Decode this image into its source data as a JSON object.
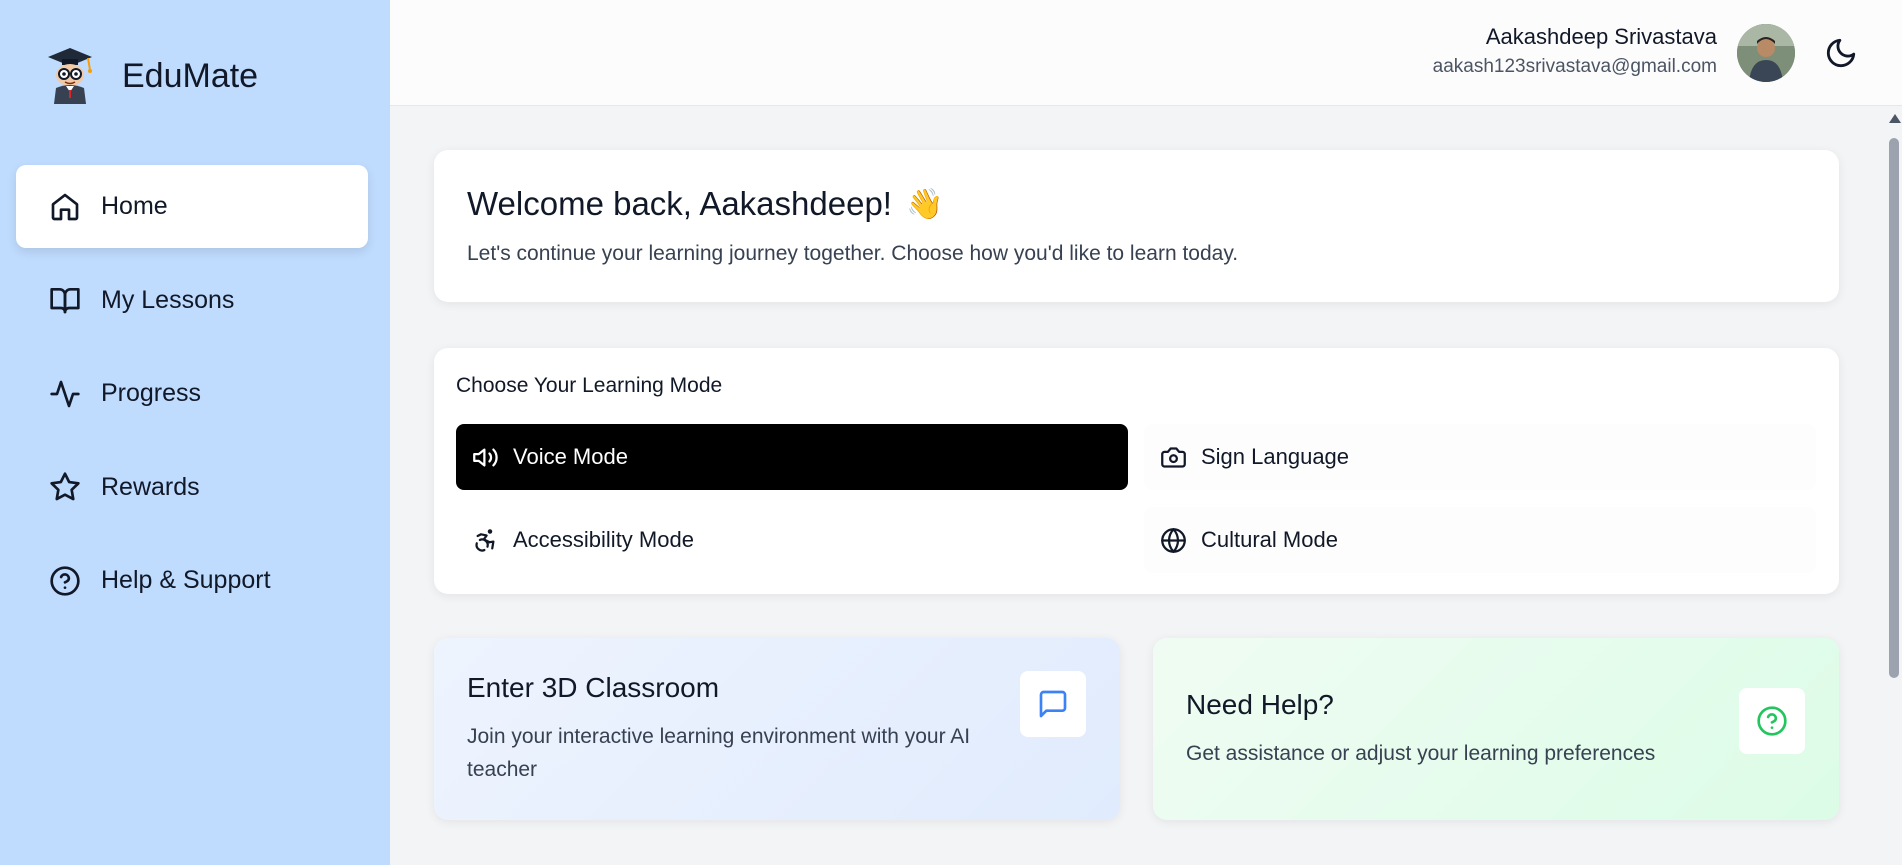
{
  "brand": {
    "name": "EduMate",
    "logo_icon": "graduate-mascot-icon"
  },
  "sidebar": {
    "items": [
      {
        "label": "Home",
        "icon": "home-icon",
        "active": true
      },
      {
        "label": "My Lessons",
        "icon": "book-open-icon",
        "active": false
      },
      {
        "label": "Progress",
        "icon": "activity-icon",
        "active": false
      },
      {
        "label": "Rewards",
        "icon": "star-icon",
        "active": false
      },
      {
        "label": "Help & Support",
        "icon": "help-circle-icon",
        "active": false
      }
    ]
  },
  "header": {
    "user_name": "Aakashdeep Srivastava",
    "user_email": "aakash123srivastava@gmail.com",
    "theme_icon": "moon-icon"
  },
  "welcome": {
    "title": "Welcome back, Aakashdeep!",
    "emoji": "👋",
    "subtitle": "Let's continue your learning journey together. Choose how you'd like to learn today."
  },
  "modes": {
    "title": "Choose Your Learning Mode",
    "items": [
      {
        "label": "Voice Mode",
        "icon": "speaker-icon",
        "active": true
      },
      {
        "label": "Sign Language",
        "icon": "camera-icon",
        "active": false
      },
      {
        "label": "Accessibility Mode",
        "icon": "accessibility-icon",
        "active": false
      },
      {
        "label": "Cultural Mode",
        "icon": "globe-icon",
        "active": false
      }
    ]
  },
  "classroom": {
    "title": "Enter 3D Classroom",
    "description": "Join your interactive learning environment with your AI teacher",
    "icon": "message-square-icon",
    "accent": "#3b82f6"
  },
  "help": {
    "title": "Need Help?",
    "description": "Get assistance or adjust your learning preferences",
    "icon": "help-circle-icon",
    "accent": "#22c55e"
  },
  "colors": {
    "sidebar_bg": "#bfdbfe",
    "active_mode_bg": "#000000",
    "page_bg": "#f3f4f6"
  }
}
